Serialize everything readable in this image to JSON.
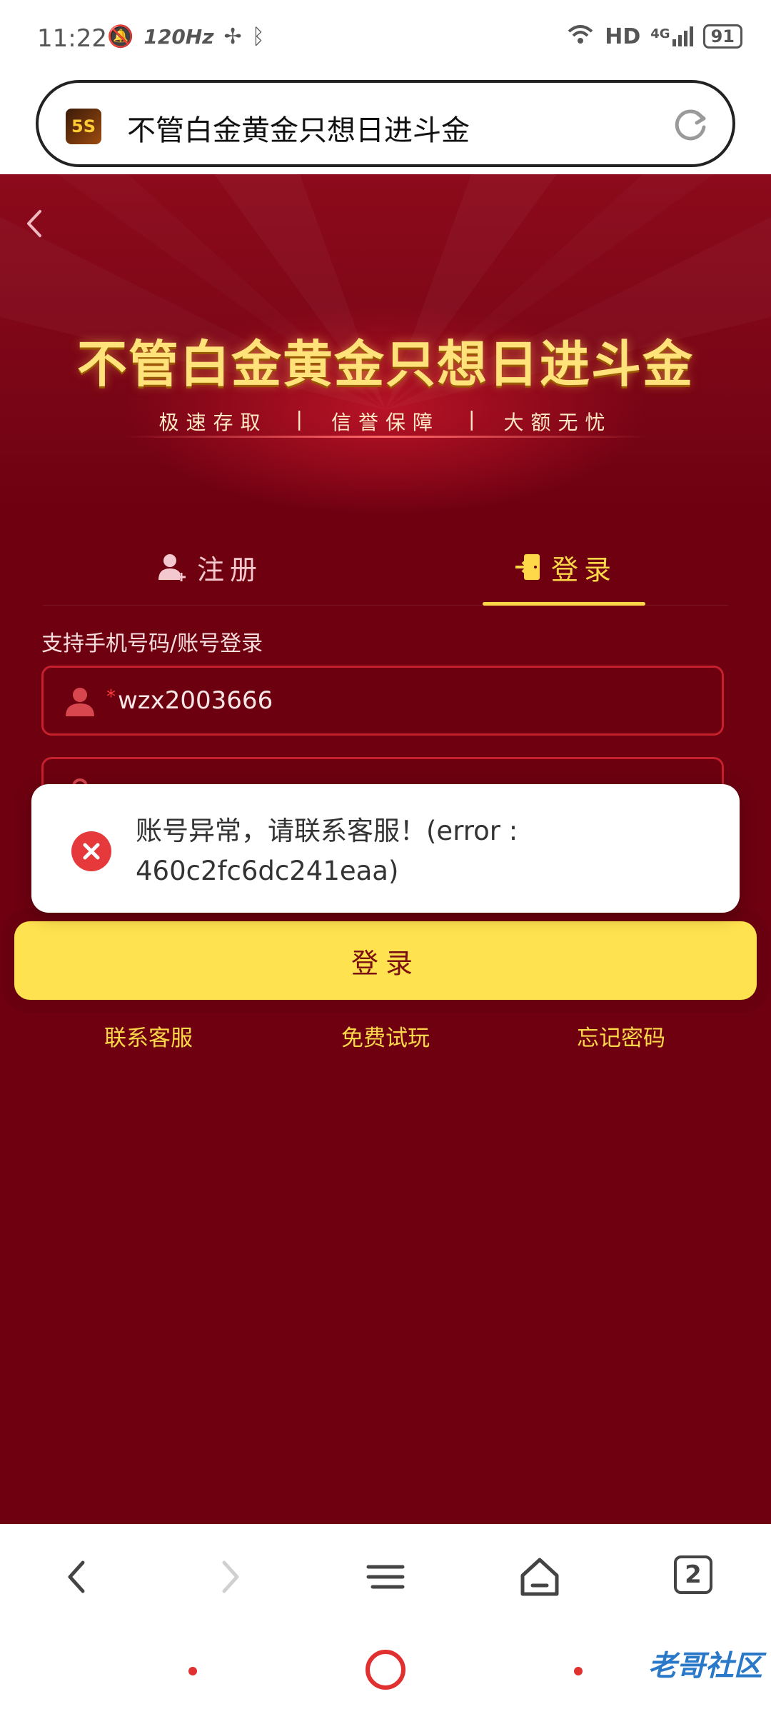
{
  "status_bar": {
    "time": "11:22",
    "refresh_rate": "120Hz",
    "network": "HD",
    "signal": "4G",
    "battery": "91"
  },
  "address_bar": {
    "logo_text": "5S",
    "title": "不管白金黄金只想日进斗金"
  },
  "hero": {
    "title": "不管白金黄金只想日进斗金",
    "slogans": [
      "极速存取",
      "信誉保障",
      "大额无忧"
    ],
    "separator": "|"
  },
  "tabs": [
    {
      "label": "注册",
      "active": false
    },
    {
      "label": "登录",
      "active": true
    }
  ],
  "form": {
    "hint": "支持手机号码/账号登录",
    "account_required_mark": "*",
    "account_value": "wzx2003666"
  },
  "toast": {
    "message": "账号异常，请联系客服！(error : 460c2fc6dc241eaa)"
  },
  "login_button": "登录",
  "links": [
    "联系客服",
    "免费试玩",
    "忘记密码"
  ],
  "browser_nav": {
    "tab_count": "2"
  },
  "watermark": "老哥社区",
  "colors": {
    "page_bg": "#6e0010",
    "accent_gold": "#ffd84a",
    "button_yellow": "#ffe24f",
    "error_red": "#e5393c"
  }
}
